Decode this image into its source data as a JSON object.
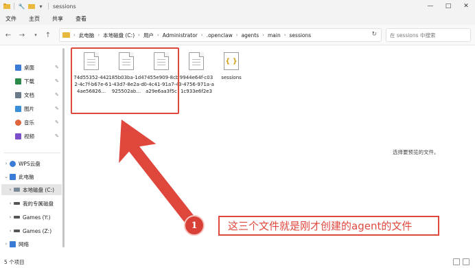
{
  "window": {
    "title": "sessions",
    "controls": [
      "—",
      "□",
      "✕"
    ]
  },
  "ribbon": {
    "tabs": [
      "文件",
      "主页",
      "共享",
      "查看"
    ]
  },
  "address_bar": {
    "breadcrumbs": [
      "此电脑",
      "本地磁盘 (C:)",
      "用户",
      "Administrator",
      ".openclaw",
      "agents",
      "main",
      "sessions"
    ],
    "search_placeholder": "在 sessions 中搜索"
  },
  "sidebar": {
    "quick_access": [
      {
        "label": "桌面",
        "icon": "desktop-icon",
        "color": "#3a7bd5"
      },
      {
        "label": "下载",
        "icon": "download-icon",
        "color": "#2a8a4a"
      },
      {
        "label": "文档",
        "icon": "documents-icon",
        "color": "#6b7b8c"
      },
      {
        "label": "图片",
        "icon": "pictures-icon",
        "color": "#3a8fd8"
      },
      {
        "label": "音乐",
        "icon": "music-icon",
        "color": "#e0643a"
      },
      {
        "label": "视频",
        "icon": "videos-icon",
        "color": "#7a4fc9"
      }
    ],
    "locations": [
      {
        "label": "WPS云盘",
        "icon": "cloud-icon",
        "color": "#3a7bd5"
      },
      {
        "label": "此电脑",
        "icon": "computer-icon",
        "color": "#3a7bd5"
      },
      {
        "label": "本地磁盘 (C:)",
        "icon": "drive-icon",
        "color": "#7a8a99"
      },
      {
        "label": "我的专属磁盘",
        "icon": "drive-icon",
        "color": "#555555"
      },
      {
        "label": "Games (Y:)",
        "icon": "drive-icon",
        "color": "#555555"
      },
      {
        "label": "Games (Z:)",
        "icon": "drive-icon",
        "color": "#555555"
      },
      {
        "label": "网络",
        "icon": "network-icon",
        "color": "#3a7bd5"
      }
    ]
  },
  "files": [
    {
      "name": "74d55352-4422-4c7f-b67e-64ae56826...",
      "type": "document"
    },
    {
      "name": "185b03ba-1d41-43d7-8e2a-d925502ab...",
      "type": "document"
    },
    {
      "name": "7455e909-8cb0-4c41-91a7-4a29e6aa3f5c",
      "type": "document"
    },
    {
      "name": "9944e64f-c033-4756-971a-a1c933e6f2e3",
      "type": "document"
    },
    {
      "name": "sessions",
      "type": "json"
    }
  ],
  "preview_message": "选择要预览的文件。",
  "annotation": {
    "badge": "1",
    "text": "这三个文件就是刚才创建的agent的文件",
    "color": "#e0473c"
  },
  "status": {
    "item_count": "5 个项目"
  }
}
